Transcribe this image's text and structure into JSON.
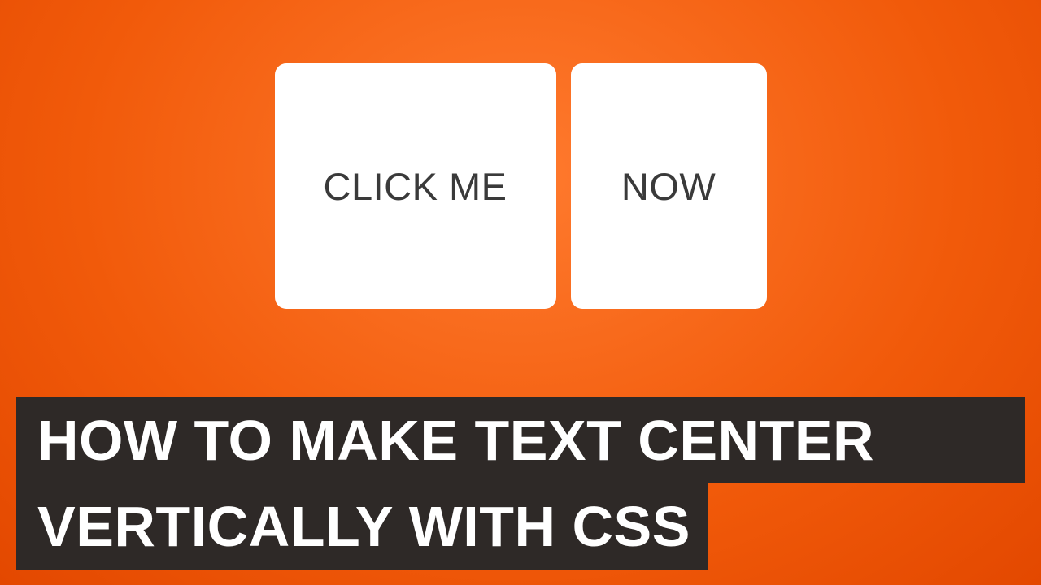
{
  "cards": {
    "left": "CLICK ME",
    "right": "NOW"
  },
  "title": {
    "line1": "HOW TO MAKE TEXT CENTER",
    "line2": "VERTICALLY WITH CSS"
  },
  "colors": {
    "background": "#f15a0a",
    "cardBg": "#ffffff",
    "cardText": "#3a3a3a",
    "titleBg": "#2e2927",
    "titleText": "#ffffff"
  }
}
